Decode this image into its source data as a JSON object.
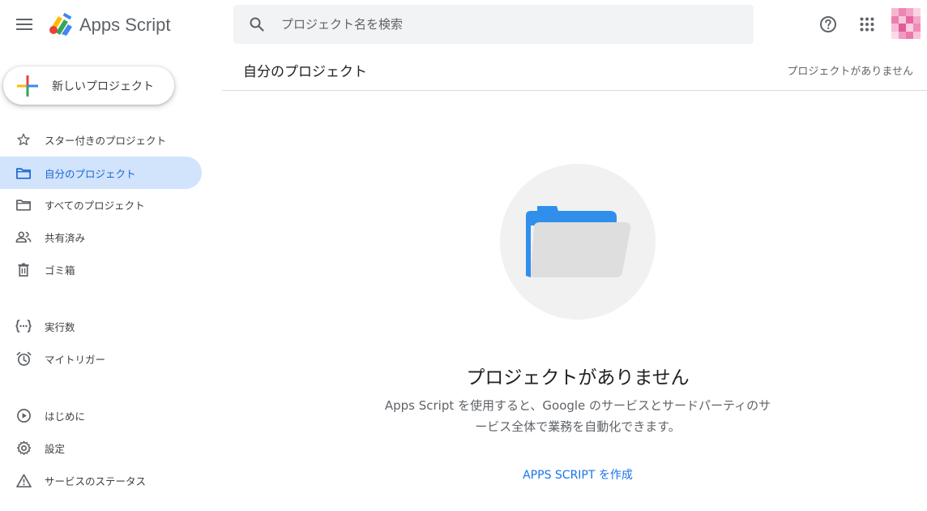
{
  "header": {
    "app_title": "Apps Script",
    "search_placeholder": "プロジェクト名を検索",
    "icons": {
      "menu": "menu-icon",
      "search": "search-icon",
      "help": "help-icon",
      "apps": "apps-grid-icon"
    }
  },
  "sidebar": {
    "new_project_label": "新しいプロジェクト",
    "items": [
      {
        "label": "スター付きのプロジェクト",
        "icon": "star-icon",
        "active": false
      },
      {
        "label": "自分のプロジェクト",
        "icon": "folder-icon",
        "active": true
      },
      {
        "label": "すべてのプロジェクト",
        "icon": "folder-icon",
        "active": false
      },
      {
        "label": "共有済み",
        "icon": "people-icon",
        "active": false
      },
      {
        "label": "ゴミ箱",
        "icon": "trash-icon",
        "active": false
      },
      {
        "label": "実行数",
        "icon": "executions-icon",
        "active": false
      },
      {
        "label": "マイトリガー",
        "icon": "alarm-icon",
        "active": false
      },
      {
        "label": "はじめに",
        "icon": "play-circle-icon",
        "active": false
      },
      {
        "label": "設定",
        "icon": "gear-icon",
        "active": false
      },
      {
        "label": "サービスのステータス",
        "icon": "warning-icon",
        "active": false
      }
    ]
  },
  "main": {
    "title": "自分のプロジェクト",
    "status": "プロジェクトがありません",
    "empty_title": "プロジェクトがありません",
    "empty_description_line1": "Apps Script を使用すると、Google のサービスとサードパーティのサ",
    "empty_description_line2": "ービス全体で業務を自動化できます。",
    "create_link": "APPS SCRIPT を作成"
  },
  "colors": {
    "accent": "#1a73e8",
    "active_nav_bg": "#d2e3fc",
    "active_nav_text": "#1967d2",
    "search_bg": "#f1f3f4",
    "folder_blue": "#2f8fea",
    "folder_gray": "#dedede"
  }
}
